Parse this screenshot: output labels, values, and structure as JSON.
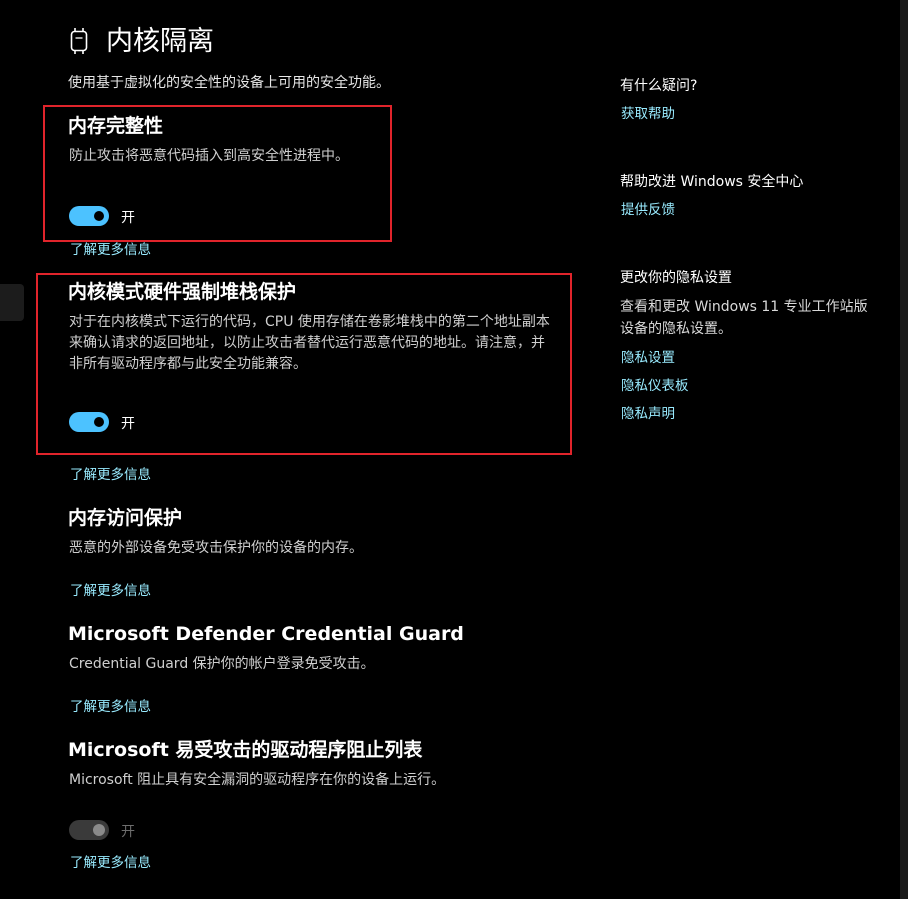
{
  "header": {
    "title": "内核隔离",
    "description": "使用基于虚拟化的安全性的设备上可用的安全功能。",
    "icon": "chip-icon"
  },
  "sections": [
    {
      "title": "内存完整性",
      "description": "防止攻击将恶意代码插入到高安全性进程中。",
      "toggle": {
        "state": "on",
        "label": "开",
        "enabled": true
      },
      "link": "了解更多信息"
    },
    {
      "title": "内核模式硬件强制堆栈保护",
      "description": "对于在内核模式下运行的代码，CPU 使用存储在卷影堆栈中的第二个地址副本来确认请求的返回地址，以防止攻击者替代运行恶意代码的地址。请注意，并非所有驱动程序都与此安全功能兼容。",
      "toggle": {
        "state": "on",
        "label": "开",
        "enabled": true
      },
      "link": "了解更多信息"
    },
    {
      "title": "内存访问保护",
      "description": "恶意的外部设备免受攻击保护你的设备的内存。",
      "link": "了解更多信息"
    },
    {
      "title": "Microsoft Defender Credential Guard",
      "description": "Credential Guard 保护你的帐户登录免受攻击。",
      "link": "了解更多信息"
    },
    {
      "title": "Microsoft 易受攻击的驱动程序阻止列表",
      "description": "Microsoft 阻止具有安全漏洞的驱动程序在你的设备上运行。",
      "toggle": {
        "state": "on",
        "label": "开",
        "enabled": false
      },
      "link": "了解更多信息"
    }
  ],
  "sidebar": {
    "help_heading": "有什么疑问?",
    "help_link": "获取帮助",
    "improve_heading": "帮助改进 Windows 安全中心",
    "feedback_link": "提供反馈",
    "privacy_heading": "更改你的隐私设置",
    "privacy_text": "查看和更改 Windows 11 专业工作站版 设备的隐私设置。",
    "privacy_links": [
      "隐私设置",
      "隐私仪表板",
      "隐私声明"
    ]
  },
  "colors": {
    "background": "#000000",
    "accent": "#4cc2ff",
    "link": "#99ebff",
    "highlight_box": "#e0242b"
  }
}
